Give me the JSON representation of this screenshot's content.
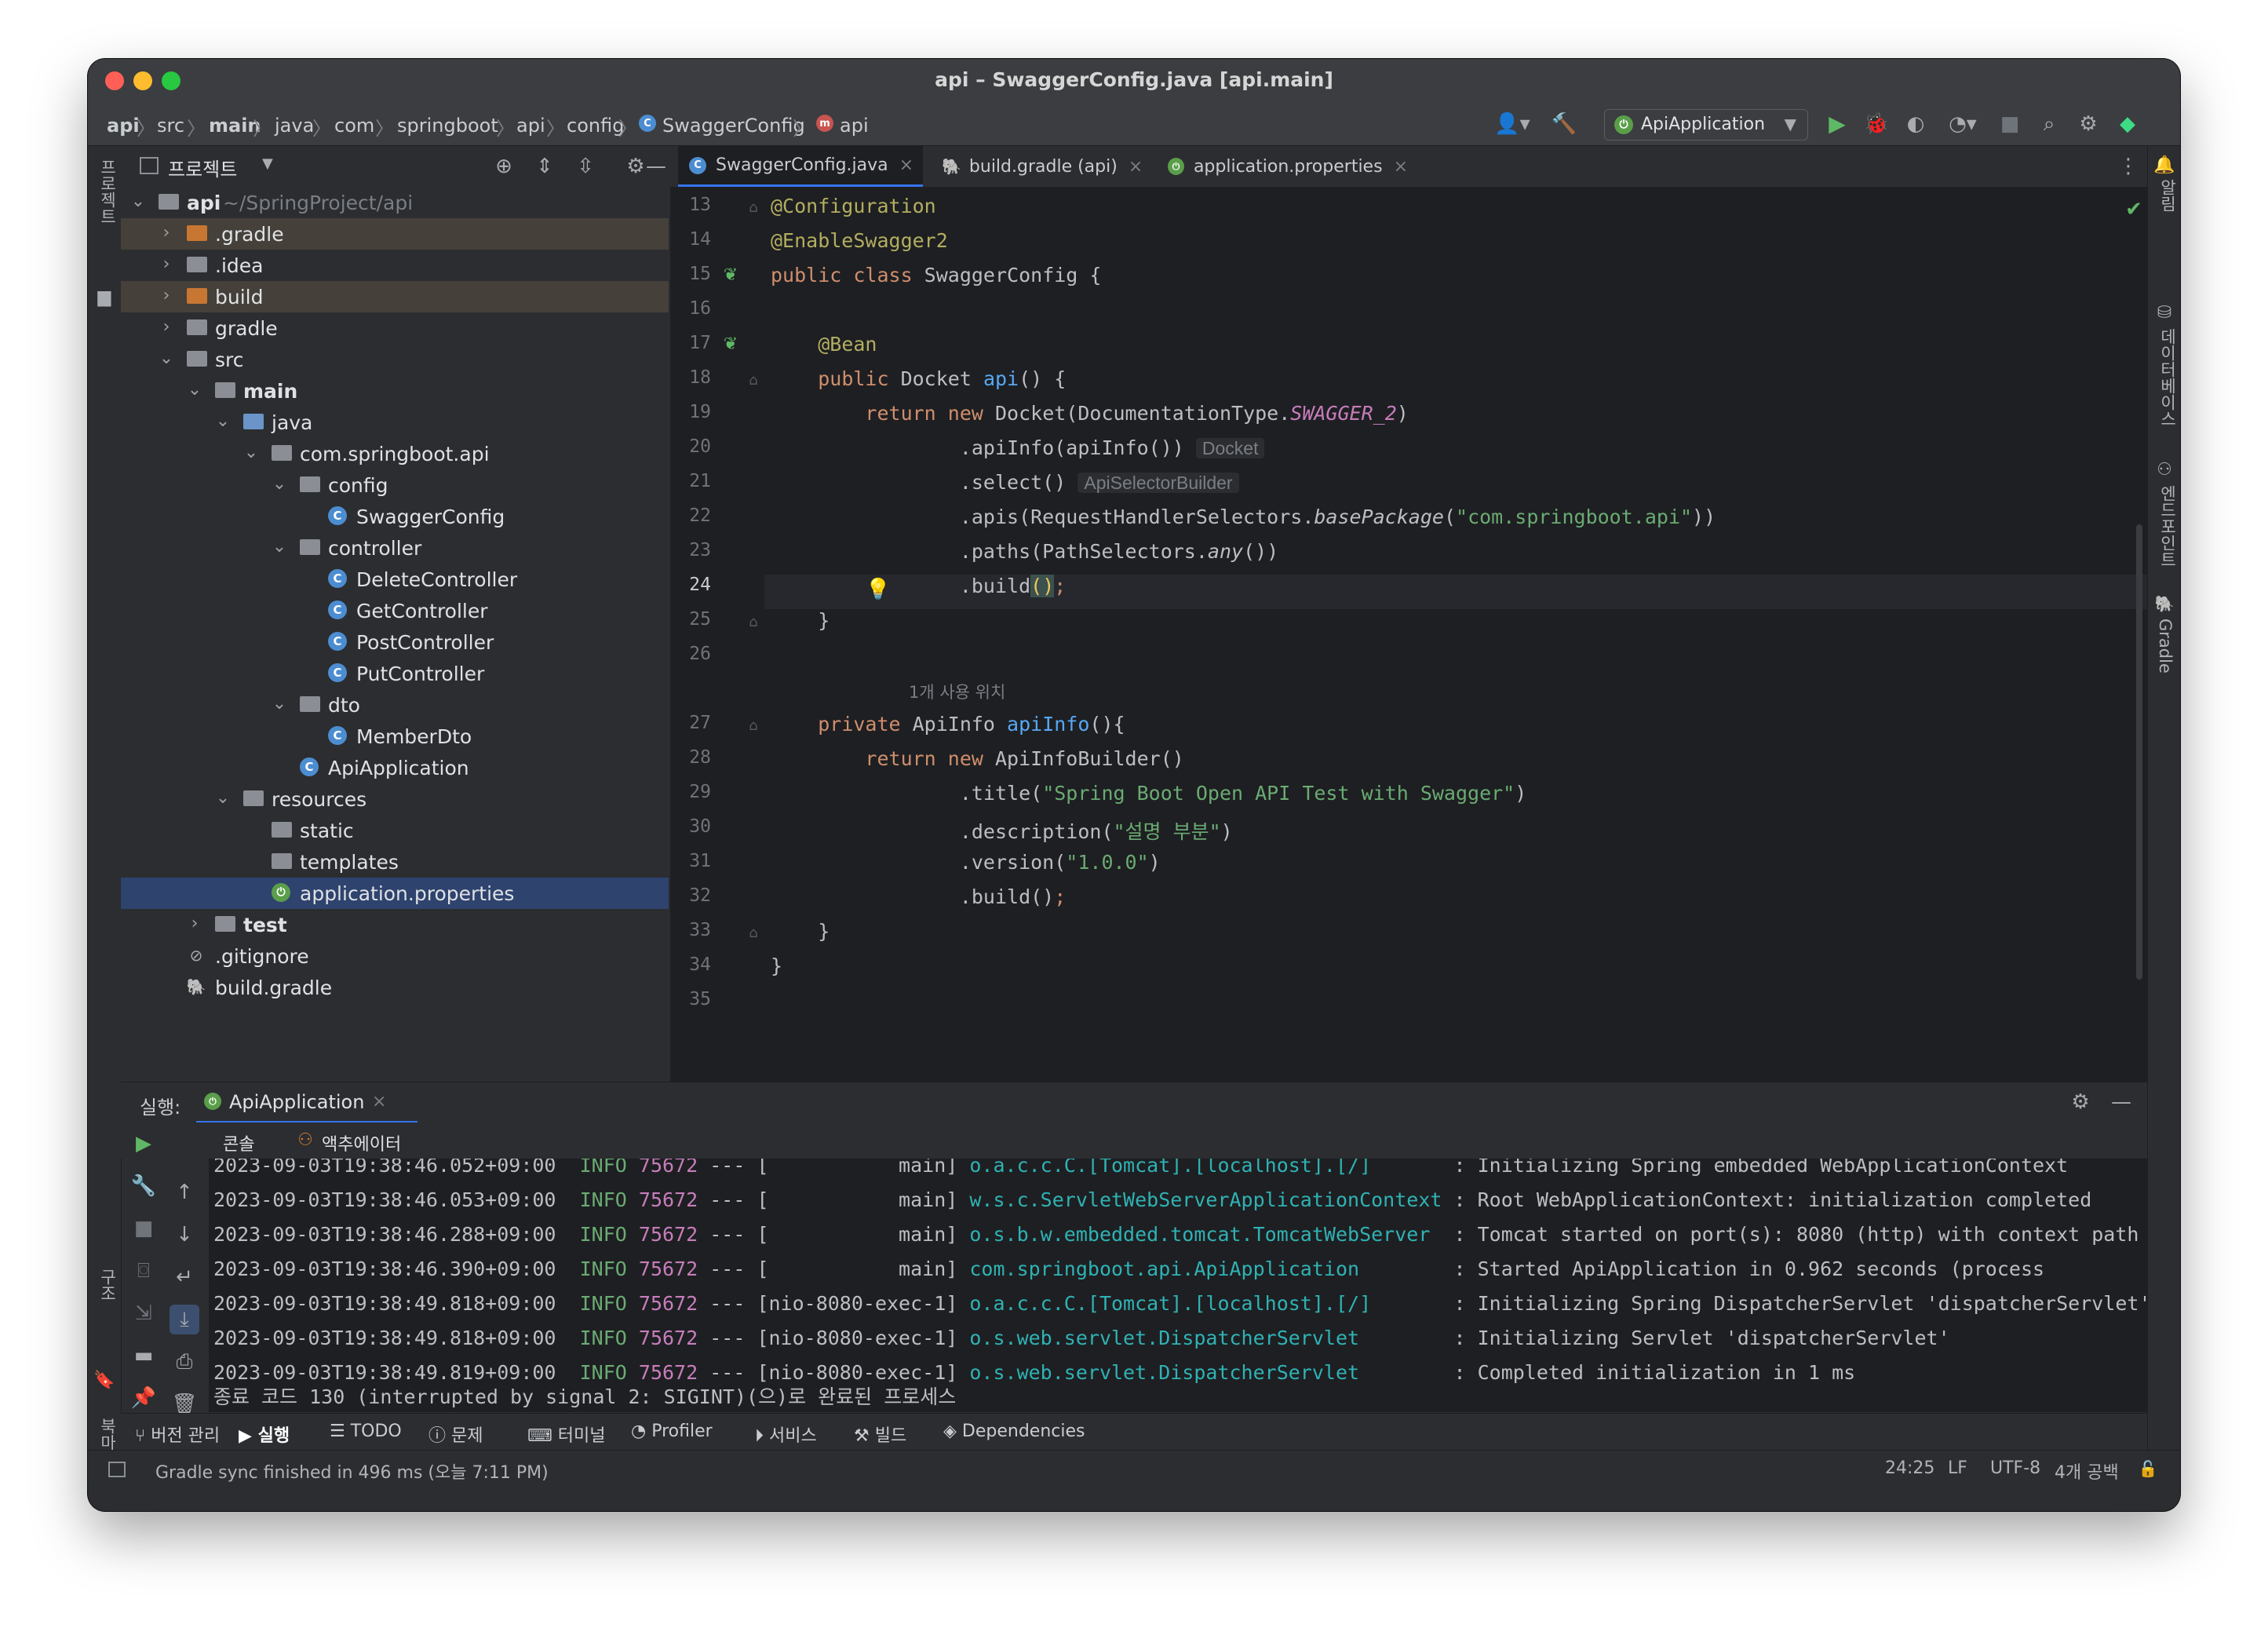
{
  "window": {
    "title": "api – SwaggerConfig.java [api.main]"
  },
  "breadcrumbs": [
    "api",
    "src",
    "main",
    "java",
    "com",
    "springboot",
    "api",
    "config",
    "SwaggerConfig",
    "api"
  ],
  "toolbar": {
    "run_config": "ApiApplication"
  },
  "left_strip": {
    "project_label": "프로젝트",
    "structure_label": "구조",
    "bookmarks_label": "북마크"
  },
  "right_strip": {
    "notifications_label": "알림",
    "database_label": "데이터베이스",
    "endpoints_label": "엔드포인트",
    "gradle_label": "Gradle"
  },
  "project": {
    "header": "프로젝트",
    "tree": [
      {
        "label": "api",
        "suffix": "~/SpringProject/api"
      },
      {
        "label": ".gradle"
      },
      {
        "label": ".idea"
      },
      {
        "label": "build"
      },
      {
        "label": "gradle"
      },
      {
        "label": "src"
      },
      {
        "label": "main"
      },
      {
        "label": "java"
      },
      {
        "label": "com.springboot.api"
      },
      {
        "label": "config"
      },
      {
        "label": "SwaggerConfig"
      },
      {
        "label": "controller"
      },
      {
        "label": "DeleteController"
      },
      {
        "label": "GetController"
      },
      {
        "label": "PostController"
      },
      {
        "label": "PutController"
      },
      {
        "label": "dto"
      },
      {
        "label": "MemberDto"
      },
      {
        "label": "ApiApplication"
      },
      {
        "label": "resources"
      },
      {
        "label": "static"
      },
      {
        "label": "templates"
      },
      {
        "label": "application.properties"
      },
      {
        "label": "test"
      },
      {
        "label": ".gitignore"
      },
      {
        "label": "build.gradle"
      }
    ]
  },
  "editor": {
    "tabs": [
      {
        "label": "SwaggerConfig.java"
      },
      {
        "label": "build.gradle (api)"
      },
      {
        "label": "application.properties"
      }
    ],
    "line_numbers": [
      "13",
      "14",
      "15",
      "16",
      "17",
      "18",
      "19",
      "20",
      "21",
      "22",
      "23",
      "24",
      "25",
      "26",
      "27",
      "28",
      "29",
      "30",
      "31",
      "32",
      "33",
      "34",
      "35"
    ],
    "usage_hint": "1개 사용 위치",
    "inlay_docket": "Docket",
    "inlay_selector": "ApiSelectorBuilder",
    "code": {
      "l13": "@Configuration",
      "l14": "@EnableSwagger2",
      "l15_kw": "public class",
      "l15_rest": " SwaggerConfig {",
      "l17": "@Bean",
      "l18_kw": "public",
      "l18_type": " Docket ",
      "l18_fn": "api",
      "l18_rest": "() {",
      "l19_kw": "return new",
      "l19_a": " Docket(DocumentationType.",
      "l19_const": "SWAGGER_2",
      "l19_b": ")",
      "l20": ".apiInfo(apiInfo())",
      "l21": ".select()",
      "l22_a": ".apis(RequestHandlerSelectors.",
      "l22_it": "basePackage",
      "l22_b": "(",
      "l22_str": "\"com.springboot.api\"",
      "l22_c": "))",
      "l23_a": ".paths(PathSelectors.",
      "l23_it": "any",
      "l23_b": "())",
      "l24_a": ".build",
      "l24_b": "()",
      "l24_c": ";",
      "l25": "}",
      "l27_kw": "private",
      "l27_type": " ApiInfo ",
      "l27_fn": "apiInfo",
      "l27_rest": "(){",
      "l28_kw": "return new",
      "l28_rest": " ApiInfoBuilder()",
      "l29_a": ".title(",
      "l29_str": "\"Spring Boot Open API Test with Swagger\"",
      "l29_b": ")",
      "l30_a": ".description(",
      "l30_str": "\"설명 부분\"",
      "l30_b": ")",
      "l31_a": ".version(",
      "l31_str": "\"1.0.0\"",
      "l31_b": ")",
      "l32_a": ".build()",
      "l32_b": ";",
      "l33": "}",
      "l34": "}"
    }
  },
  "run": {
    "label": "실행:",
    "tab": "ApiApplication",
    "sub_console": "콘솔",
    "sub_actuator": "액추에이터",
    "logs": [
      {
        "ts": "2023-09-03T19:38:46.052+09:00",
        "lvl": "INFO",
        "pid": "75672",
        "sep": "---",
        "thread": "[           main]",
        "logger": "o.a.c.c.C.[Tomcat].[localhost].[/]      ",
        "msg": " : Initializing Spring embedded WebApplicationContext"
      },
      {
        "ts": "2023-09-03T19:38:46.053+09:00",
        "lvl": "INFO",
        "pid": "75672",
        "sep": "---",
        "thread": "[           main]",
        "logger": "w.s.c.ServletWebServerApplicationContext",
        "msg": " : Root WebApplicationContext: initialization completed"
      },
      {
        "ts": "2023-09-03T19:38:46.288+09:00",
        "lvl": "INFO",
        "pid": "75672",
        "sep": "---",
        "thread": "[           main]",
        "logger": "o.s.b.w.embedded.tomcat.TomcatWebServer ",
        "msg": " : Tomcat started on port(s): 8080 (http) with context path"
      },
      {
        "ts": "2023-09-03T19:38:46.390+09:00",
        "lvl": "INFO",
        "pid": "75672",
        "sep": "---",
        "thread": "[           main]",
        "logger": "com.springboot.api.ApiApplication       ",
        "msg": " : Started ApiApplication in 0.962 seconds (process"
      },
      {
        "ts": "2023-09-03T19:38:49.818+09:00",
        "lvl": "INFO",
        "pid": "75672",
        "sep": "---",
        "thread": "[nio-8080-exec-1]",
        "logger": "o.a.c.c.C.[Tomcat].[localhost].[/]      ",
        "msg": " : Initializing Spring DispatcherServlet 'dispatcherServlet'"
      },
      {
        "ts": "2023-09-03T19:38:49.818+09:00",
        "lvl": "INFO",
        "pid": "75672",
        "sep": "---",
        "thread": "[nio-8080-exec-1]",
        "logger": "o.s.web.servlet.DispatcherServlet       ",
        "msg": " : Initializing Servlet 'dispatcherServlet'"
      },
      {
        "ts": "2023-09-03T19:38:49.819+09:00",
        "lvl": "INFO",
        "pid": "75672",
        "sep": "---",
        "thread": "[nio-8080-exec-1]",
        "logger": "o.s.web.servlet.DispatcherServlet       ",
        "msg": " : Completed initialization in 1 ms"
      }
    ],
    "exit_message": "종료 코드 130 (interrupted by signal 2: SIGINT)(으)로 완료된 프로세스"
  },
  "bottom_tabs": [
    "버전 관리",
    "실행",
    "TODO",
    "문제",
    "터미널",
    "Profiler",
    "서비스",
    "빌드",
    "Dependencies"
  ],
  "status": {
    "message": "Gradle sync finished in 496 ms (오늘 7:11 PM)",
    "position": "24:25",
    "line_sep": "LF",
    "encoding": "UTF-8",
    "indent": "4개 공백"
  },
  "colors": {
    "accent": "#3574f0",
    "run_green": "#5fb865",
    "bulb": "#f2c55c"
  }
}
